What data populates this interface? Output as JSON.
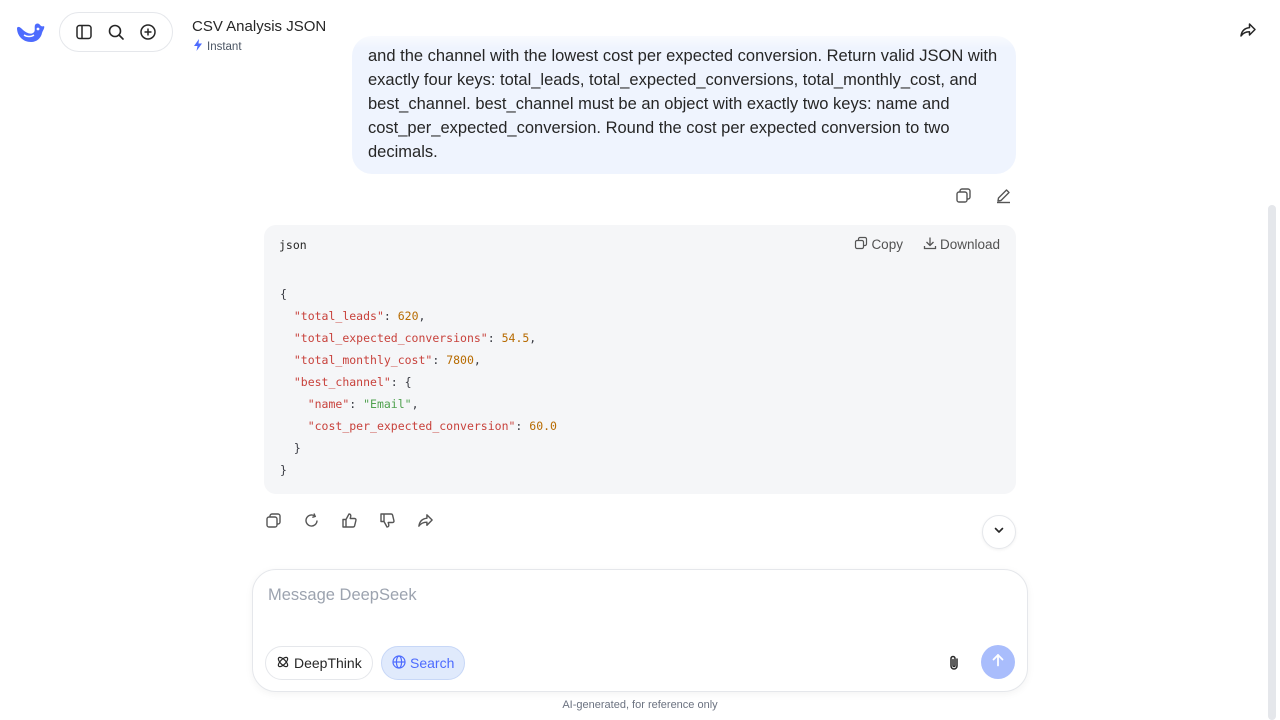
{
  "header": {
    "title": "CSV Analysis JSON",
    "mode": "Instant"
  },
  "user_message": {
    "text": "and the channel with the lowest cost per expected conversion. Return valid JSON with exactly four keys: total_leads, total_expected_conversions, total_monthly_cost, and best_channel. best_channel must be an object with exactly two keys: name and cost_per_expected_conversion. Round the cost per expected conversion to two decimals."
  },
  "code_block": {
    "language": "json",
    "copy_label": "Copy",
    "download_label": "Download",
    "lines": {
      "l0": "{",
      "k1": "\"total_leads\"",
      "v1": "620",
      "k2": "\"total_expected_conversions\"",
      "v2": "54.5",
      "k3": "\"total_monthly_cost\"",
      "v3": "7800",
      "k4": "\"best_channel\"",
      "k5": "\"name\"",
      "v5": "\"Email\"",
      "k6": "\"cost_per_expected_conversion\"",
      "v6": "60.0",
      "close_inner": "}",
      "close_outer": "}"
    }
  },
  "composer": {
    "placeholder": "Message DeepSeek",
    "deepthink_label": "DeepThink",
    "search_label": "Search"
  },
  "footer_note": "AI-generated, for reference only",
  "colors": {
    "accent": "#4d6bfe",
    "bubble_bg": "#eff4fe",
    "code_bg": "#f5f6f8"
  }
}
